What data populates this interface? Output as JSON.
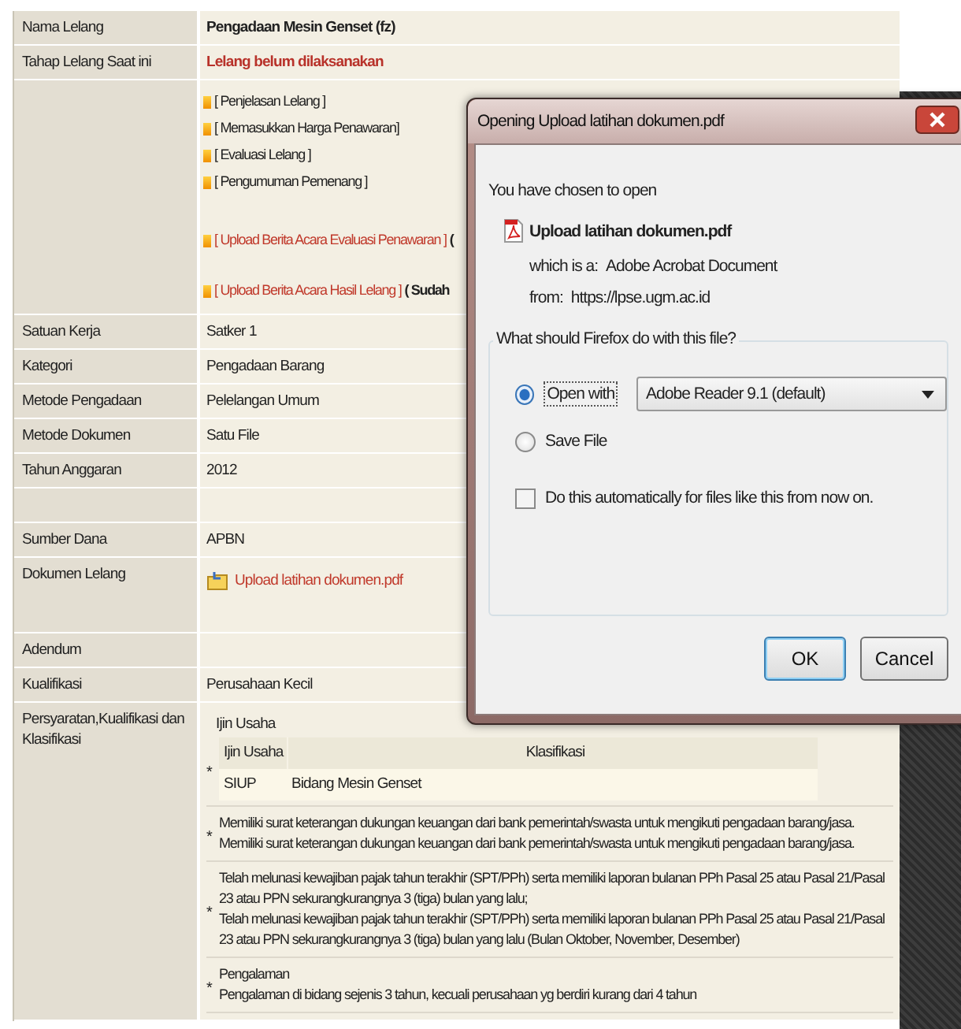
{
  "rows": [
    {
      "kind": "bold",
      "label": "Nama Lelang",
      "value": "Pengadaan Mesin Genset (fz)"
    },
    {
      "kind": "status",
      "label": "Tahap Lelang Saat ini",
      "value": "Lelang belum dilaksanakan"
    },
    {
      "kind": "links",
      "links": [
        {
          "kind": "menu",
          "text": "[ Penjelasan Lelang ]"
        },
        {
          "kind": "menu",
          "text": "[ Memasukkan Harga Penawaran]"
        },
        {
          "kind": "menu",
          "text": "[ Evaluasi Lelang ]"
        },
        {
          "kind": "menu",
          "text": "[ Pengumuman Pemenang ]"
        },
        {
          "kind": "upload",
          "text": "[ Upload Berita Acara Evaluasi Penawaran ]",
          "suffix": "("
        },
        {
          "kind": "upload",
          "text": "[ Upload Berita Acara Hasil Lelang ]",
          "suffix": "( Sudah"
        }
      ]
    },
    {
      "kind": "plain",
      "label": "Satuan Kerja",
      "value": "Satker 1"
    },
    {
      "kind": "plain",
      "label": "Kategori",
      "value": "Pengadaan Barang"
    },
    {
      "kind": "plain",
      "label": "Metode Pengadaan",
      "value": "Pelelangan Umum"
    },
    {
      "kind": "plain",
      "label": "Metode Dokumen",
      "value": "Satu File"
    },
    {
      "kind": "plain",
      "label": "Tahun Anggaran",
      "value": "2012"
    },
    {
      "kind": "plain"
    },
    {
      "kind": "plain",
      "label": "Sumber Dana",
      "value": "APBN"
    },
    {
      "kind": "file",
      "label": "Dokumen Lelang",
      "value": "Upload latihan dokumen.pdf"
    },
    {
      "kind": "plain",
      "label": "Adendum"
    },
    {
      "kind": "plain",
      "label": "Kualifikasi",
      "value": "Perusahaan Kecil"
    },
    {
      "kind": "requirements",
      "label": "Persyaratan,Kualifikasi dan Klasifikasi",
      "permit_title": "Ijin Usaha",
      "marker": "*",
      "permit_columns": [
        "Ijin Usaha",
        "Klasifikasi"
      ],
      "permit_rows": [
        [
          "SIUP",
          "Bidang Mesin Genset"
        ]
      ],
      "items": [
        {
          "lines": [
            "Memiliki surat keterangan dukungan keuangan dari bank pemerintah/swasta untuk mengikuti pengadaan barang/jasa.",
            "Memiliki surat keterangan dukungan keuangan dari bank pemerintah/swasta untuk mengikuti pengadaan barang/jasa."
          ]
        },
        {
          "lines": [
            "Telah melunasi kewajiban pajak tahun terakhir (SPT/PPh) serta memiliki laporan bulanan PPh Pasal 25 atau Pasal 21/Pasal 23 atau PPN sekurangkurangnya 3 (tiga) bulan yang lalu;",
            "Telah melunasi kewajiban pajak tahun terakhir (SPT/PPh) serta memiliki laporan bulanan PPh Pasal 25 atau Pasal 21/Pasal 23 atau PPN sekurangkurangnya 3 (tiga) bulan yang lalu (Bulan Oktober, November, Desember)"
          ]
        },
        {
          "lines": [
            "Pengalaman",
            "Pengalaman di bidang sejenis 3 tahun, kecuali perusahaan yg berdiri kurang dari 4 tahun"
          ]
        }
      ]
    }
  ],
  "dialog": {
    "title": "Opening Upload latihan dokumen.pdf",
    "intro": "You have chosen to open",
    "file_name": "Upload latihan dokumen.pdf",
    "type_label": "which is a:",
    "type_value": "Adobe Acrobat Document",
    "from_label": "from:",
    "from_value": "https://lpse.ugm.ac.id",
    "question": "What should Firefox do with this file?",
    "options": [
      {
        "label": "Open with",
        "selected": true,
        "app": "Adobe Reader 9.1 (default)"
      },
      {
        "label": "Save File",
        "selected": false
      }
    ],
    "auto": {
      "label": "Do this automatically for files like this from now on.",
      "checked": false
    },
    "buttons": [
      {
        "label": "OK",
        "default": true
      },
      {
        "label": "Cancel",
        "default": false
      }
    ]
  }
}
